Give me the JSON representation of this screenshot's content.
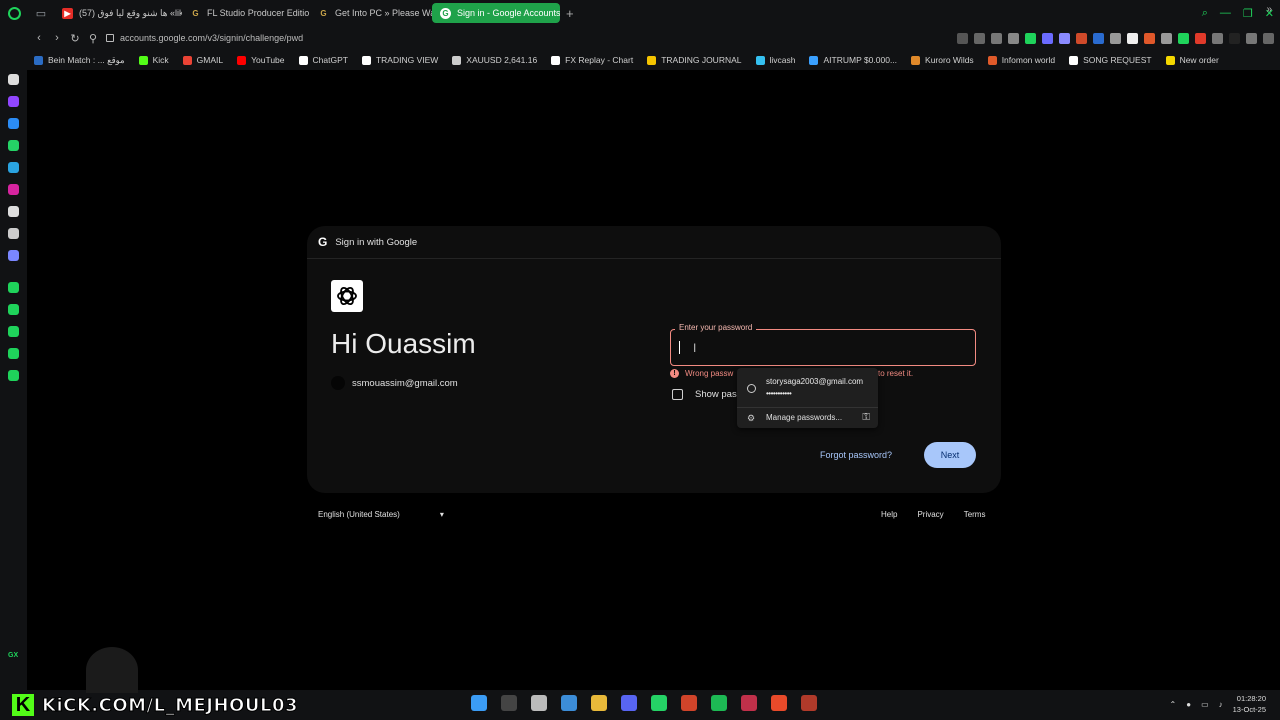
{
  "tabs": [
    {
      "label": "ha shno wqe3 lia foq (57)",
      "title_text": "(57) ها شنو وقع ليا فوق «lik",
      "favicon_color": "#e52d27"
    },
    {
      "label": "FL Studio Producer Editio",
      "favicon_color": "#caa54a"
    },
    {
      "label": "Get Into PC » Please Wait",
      "favicon_color": "#caa54a"
    },
    {
      "label": "Sign in - Google Accounts",
      "favicon_color": "#ffffff",
      "active": true
    }
  ],
  "address_bar": {
    "url": "accounts.google.com/v3/signin/challenge/pwd"
  },
  "bookmarks": [
    {
      "label": "Bein Match : ... موقع",
      "color": "#2b6cc4"
    },
    {
      "label": "Kick",
      "color": "#53fc18"
    },
    {
      "label": "GMAIL",
      "color": "#ea4335"
    },
    {
      "label": "YouTube",
      "color": "#ff0000"
    },
    {
      "label": "ChatGPT",
      "color": "#ffffff"
    },
    {
      "label": "TRADING VIEW",
      "color": "#ffffff"
    },
    {
      "label": "XAUUSD 2,641.16",
      "color": "#cccccc"
    },
    {
      "label": "FX Replay - Chart",
      "color": "#ffffff"
    },
    {
      "label": "TRADING JOURNAL",
      "color": "#f5c400"
    },
    {
      "label": "livcash",
      "color": "#35c1f1"
    },
    {
      "label": "AITRUMP $0.000...",
      "color": "#3aa0ff"
    },
    {
      "label": "Kuroro Wilds",
      "color": "#e0892a"
    },
    {
      "label": "Infomon world",
      "color": "#e05a2a"
    },
    {
      "label": "SONG REQUEST",
      "color": "#ffffff"
    },
    {
      "label": "New order",
      "color": "#f5d800"
    }
  ],
  "card": {
    "header": "Sign in with Google",
    "greeting": "Hi Ouassim",
    "email": "ssmouassim@gmail.com",
    "password_label": "Enter your password",
    "password_value": "",
    "error_text": "Wrong passw",
    "error_tail": "to reset it.",
    "show_password": "Show pas",
    "forgot_password": "Forgot password?",
    "next": "Next"
  },
  "autofill": {
    "username": "storysaga2003@gmail.com",
    "password_mask": "•••••••••••",
    "manage": "Manage passwords..."
  },
  "footer": {
    "language": "English (United States)",
    "links": [
      "Help",
      "Privacy",
      "Terms"
    ]
  },
  "stream_overlay": {
    "text": "KiCK.COM/L_MEJHOUL03",
    "k": "K"
  },
  "sidebar_badge": "GX",
  "system_tray": {
    "time": "01:28:20",
    "date": "13-Oct-25"
  },
  "colors": {
    "accent": "#1fd35b",
    "error": "#f28b82",
    "next_button": "#a8c7fa"
  }
}
